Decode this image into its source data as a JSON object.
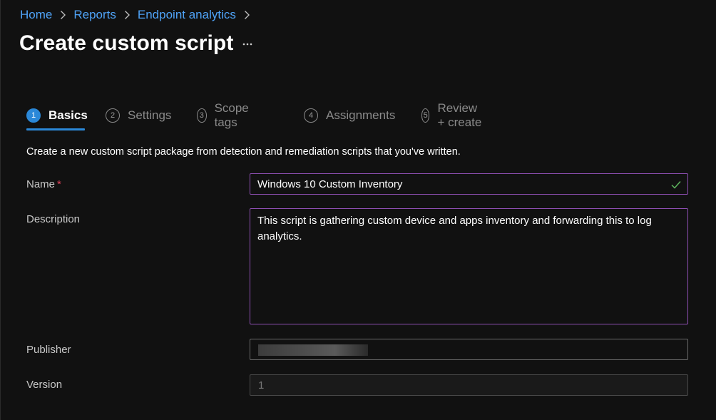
{
  "breadcrumb": {
    "items": [
      "Home",
      "Reports",
      "Endpoint analytics"
    ]
  },
  "page": {
    "title": "Create custom script"
  },
  "wizard": {
    "steps": [
      {
        "number": "1",
        "label": "Basics",
        "active": true
      },
      {
        "number": "2",
        "label": "Settings",
        "active": false
      },
      {
        "number": "3",
        "label": "Scope tags",
        "active": false
      },
      {
        "number": "4",
        "label": "Assignments",
        "active": false
      },
      {
        "number": "5",
        "label": "Review + create",
        "active": false
      }
    ]
  },
  "intro": "Create a new custom script package from detection and remediation scripts that you've written.",
  "form": {
    "name": {
      "label": "Name",
      "required_mark": "*",
      "value": "Windows 10 Custom Inventory",
      "valid": true
    },
    "description": {
      "label": "Description",
      "value": "This script is gathering custom device and apps inventory and forwarding this to log analytics."
    },
    "publisher": {
      "label": "Publisher",
      "value_redacted": true
    },
    "version": {
      "label": "Version",
      "value": "1",
      "disabled": true
    }
  },
  "colors": {
    "accent": "#2b88d8",
    "link": "#4fa3f7",
    "focus_border": "#8e4fb3",
    "required": "#e0445a",
    "valid_check": "#5db35d",
    "background": "#111111"
  },
  "icons": [
    "chevron-right-icon",
    "more-icon",
    "checkmark-icon"
  ]
}
